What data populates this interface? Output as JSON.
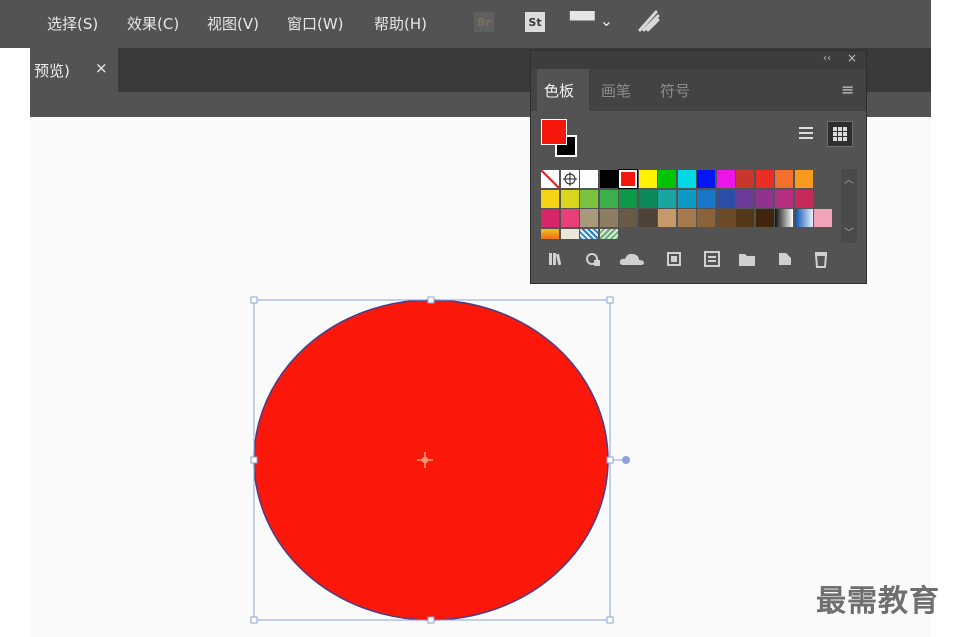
{
  "menubar": {
    "items": [
      "选择(S)",
      "效果(C)",
      "视图(V)",
      "窗口(W)",
      "帮助(H)"
    ],
    "app_buttons": [
      "Br",
      "St"
    ],
    "workspace_glyph": "▀▀ ⌄"
  },
  "document_tab": {
    "label": "预览)",
    "close": "×"
  },
  "swatches_panel": {
    "collapse": "‹‹",
    "close": "×",
    "tabs": [
      "色板",
      "画笔",
      "符号"
    ],
    "active_tab": "色板",
    "menu_icon": "≡",
    "fill_color": "#f5170c",
    "stroke_color": "#000000",
    "view_list_icon": "list-view-icon",
    "view_grid_icon": "grid-view-icon",
    "swatch_rows": [
      [
        "none",
        "registration",
        "#ffffff",
        "#000000",
        "#f5170c",
        "#fff200",
        "#00c400",
        "#00d8e6",
        "#0016f5",
        "#ee15e8",
        "#c9372c",
        "#ea2e27",
        "#f3702c",
        "#f79a1e"
      ],
      [
        "#f5d316",
        "#d7d61c",
        "#7cc241",
        "#39b04a",
        "#0f9a4a",
        "#0d8a5a",
        "#17a6a1",
        "#0d9bc5",
        "#1877c8",
        "#2b4ea8",
        "#6b3a9b",
        "#92328f",
        "#b62f82",
        "#c62a5b"
      ],
      [
        "#d6256b",
        "#e93f79",
        "#a8987c",
        "#8c7d63",
        "#695a48",
        "#4e4136",
        "#c49a6b",
        "#a57a4c",
        "#8b6339",
        "#6c4a27",
        "#543717",
        "#3e250c",
        "gradient-bw",
        "gradient-blue",
        "#f2a3b8"
      ],
      [
        "gradient-orange",
        "#ece8d9",
        "pattern-blue",
        "pattern-green"
      ]
    ],
    "footer_icons": [
      "library-icon",
      "swatch-options-icon",
      "cloud-icon",
      "swatch-group-icon",
      "open-library-icon",
      "new-group-icon",
      "new-swatch-icon",
      "delete-icon"
    ]
  },
  "artwork": {
    "shape": "ellipse",
    "fill": "#fc170b",
    "stroke": "#4a3d8a",
    "selected": true
  },
  "watermark": "最需教育"
}
